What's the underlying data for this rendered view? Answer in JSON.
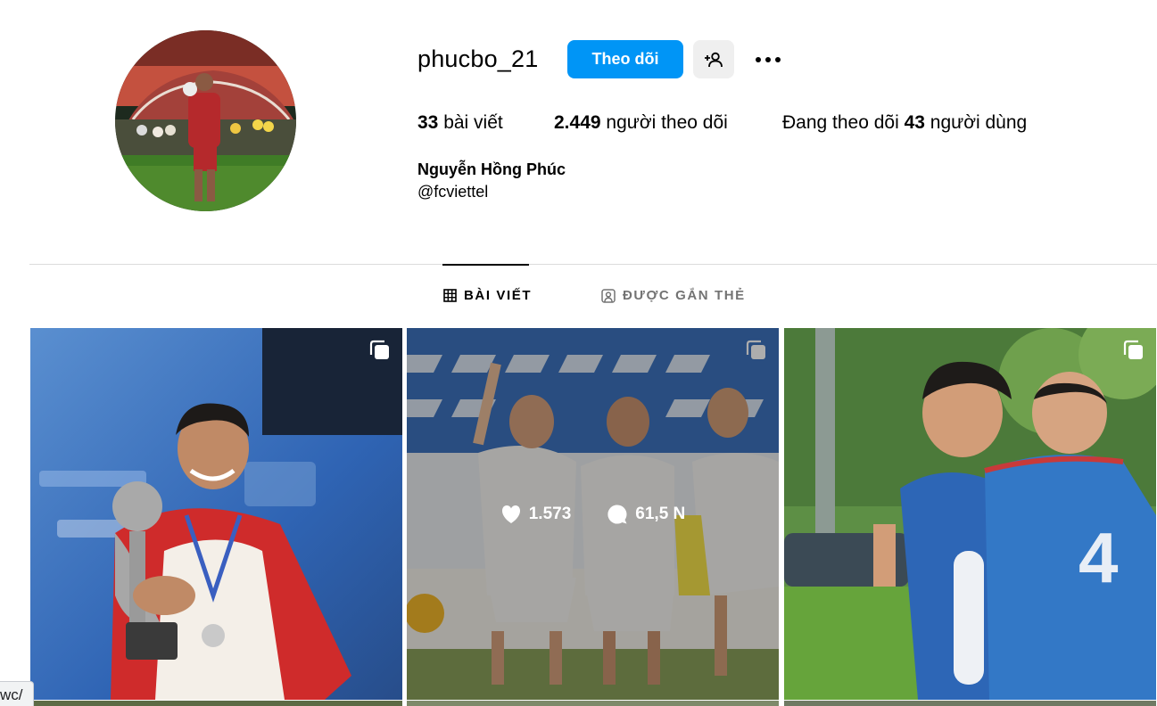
{
  "profile": {
    "username": "phucbo_21",
    "follow_label": "Theo dõi",
    "posts_count": "33",
    "posts_label": " bài viết",
    "followers_count": "2.449",
    "followers_label": " người theo dõi",
    "following_prefix": "Đang theo dõi ",
    "following_count": "43",
    "following_suffix": " người dùng",
    "full_name": "Nguyễn Hồng Phúc",
    "handle": "@fcviettel"
  },
  "icons": {
    "suggest": "person-plus-icon",
    "more": "more-horizontal-icon",
    "posts_tab": "grid-icon",
    "tagged_tab": "tagged-user-icon",
    "multi": "carousel-icon",
    "like": "heart-icon",
    "comment": "comment-icon"
  },
  "tabs": [
    {
      "label": "BÀI VIẾT",
      "active": true
    },
    {
      "label": "ĐƯỢC GẮN THẺ",
      "active": false
    }
  ],
  "posts": [
    {
      "hover": false
    },
    {
      "hover": true,
      "likes": "1.573",
      "comments": "61,5 N"
    },
    {
      "hover": false
    }
  ],
  "status_bar": {
    "text": "wc/"
  },
  "colors": {
    "primary": "#0095f6",
    "secondary_button": "#efefef",
    "muted_text": "#737373"
  }
}
